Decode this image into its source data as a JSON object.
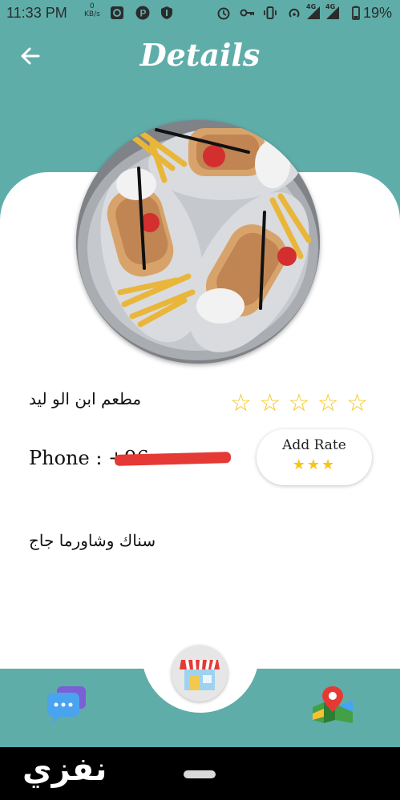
{
  "status_bar": {
    "time": "11:33 PM",
    "net_speed_value": "0",
    "net_speed_unit": "KB/s",
    "network_label_1": "4G",
    "network_label_2": "4G",
    "battery": "19%"
  },
  "app_bar": {
    "title": "Details"
  },
  "restaurant": {
    "name": "مطعم ابن الو ليد",
    "phone_label": "Phone : +96",
    "description": "سناك وشاورما جاج",
    "rating_stars": "☆☆☆☆☆"
  },
  "rate_button": {
    "label": "Add Rate",
    "stars": "★★★"
  },
  "bottom_nav": {
    "items": [
      "chat-icon",
      "shop-icon",
      "map-pin-icon"
    ]
  },
  "watermark": {
    "text": "نفزي"
  },
  "colors": {
    "teal": "#5fada9",
    "star": "#f5c518",
    "redact": "#e53935"
  }
}
